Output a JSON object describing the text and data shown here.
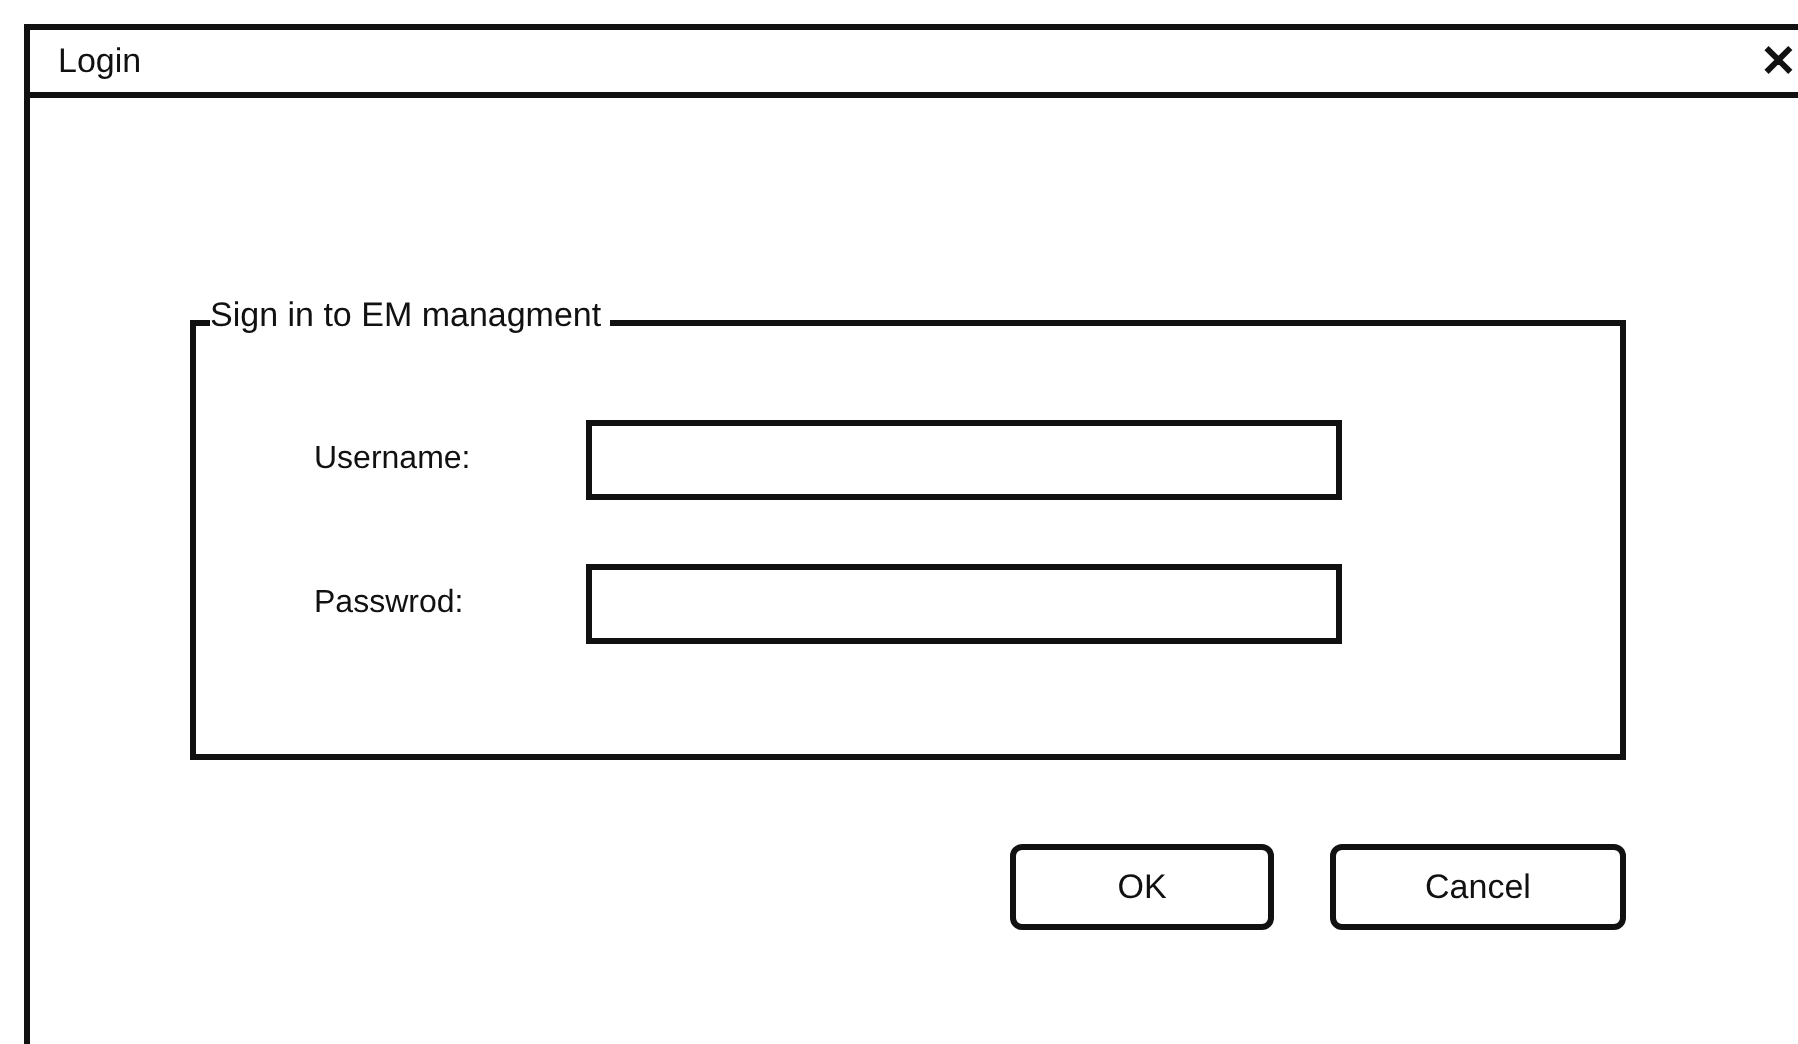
{
  "window": {
    "title": "Login",
    "close": "✕"
  },
  "group": {
    "title": "Sign in to EM managment",
    "fields": [
      {
        "label": "Username:"
      },
      {
        "label": "Passwrod:"
      }
    ]
  },
  "buttons": [
    "OK",
    "Cancel"
  ]
}
